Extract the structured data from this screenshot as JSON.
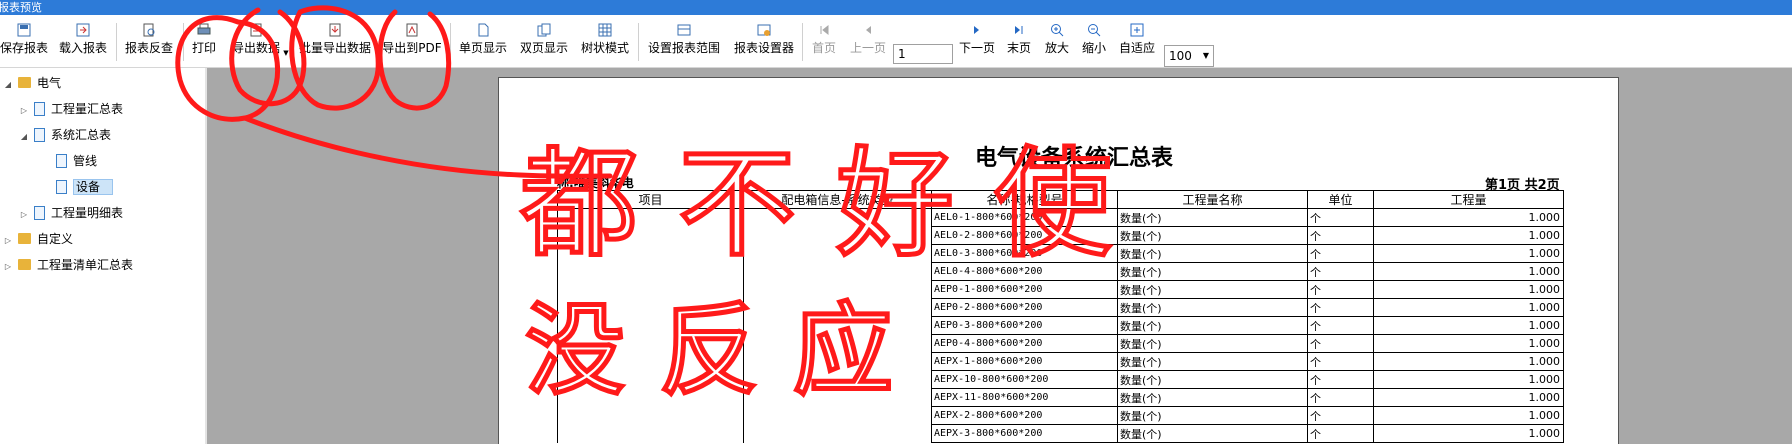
{
  "window": {
    "title": "报表预览"
  },
  "toolbar": {
    "save": "保存报表",
    "load": "载入报表",
    "reverse": "报表反查",
    "print": "打印",
    "export": "导出数据",
    "batch_export": "批量导出数据",
    "export_pdf": "导出到PDF",
    "single_page": "单页显示",
    "double_page": "双页显示",
    "tree_mode": "树状模式",
    "set_range": "设置报表范围",
    "report_settings": "报表设置器",
    "first_page": "首页",
    "prev_page": "上一页",
    "page_value": "1",
    "next_page": "下一页",
    "last_page": "末页",
    "zoom_in": "放大",
    "zoom_out": "缩小",
    "fit": "自适应",
    "zoom_value": "100"
  },
  "tree": [
    {
      "label": "电气",
      "level": 0,
      "type": "folder",
      "expanded": true
    },
    {
      "label": "工程量汇总表",
      "level": 1,
      "type": "doc",
      "expanded": false
    },
    {
      "label": "系统汇总表",
      "level": 1,
      "type": "doc",
      "expanded": true
    },
    {
      "label": "管线",
      "level": 2,
      "type": "doc"
    },
    {
      "label": "设备",
      "level": 2,
      "type": "doc",
      "selected": true
    },
    {
      "label": "工程量明细表",
      "level": 1,
      "type": "doc",
      "expanded": false
    },
    {
      "label": "自定义",
      "level": 0,
      "type": "folder",
      "expanded": false
    },
    {
      "label": "工程量清单汇总表",
      "level": 0,
      "type": "folder",
      "expanded": false
    }
  ],
  "report": {
    "title": "电气设备系统汇总表",
    "unit_label": "称:唯美斜华电",
    "page_info": "第1页  共2页",
    "headers": [
      "项目",
      "配电箱信息-系统类型",
      "名称-规格型号",
      "工程量名称",
      "单位",
      "工程量"
    ],
    "rows": [
      {
        "spec": "AEL0-1-800*600*200",
        "qname": "数量(个)",
        "unit": "个",
        "qty": "1.000"
      },
      {
        "spec": "AEL0-2-800*600*200",
        "qname": "数量(个)",
        "unit": "个",
        "qty": "1.000"
      },
      {
        "spec": "AEL0-3-800*600*200",
        "qname": "数量(个)",
        "unit": "个",
        "qty": "1.000"
      },
      {
        "spec": "AEL0-4-800*600*200",
        "qname": "数量(个)",
        "unit": "个",
        "qty": "1.000"
      },
      {
        "spec": "AEP0-1-800*600*200",
        "qname": "数量(个)",
        "unit": "个",
        "qty": "1.000"
      },
      {
        "spec": "AEP0-2-800*600*200",
        "qname": "数量(个)",
        "unit": "个",
        "qty": "1.000"
      },
      {
        "spec": "AEP0-3-800*600*200",
        "qname": "数量(个)",
        "unit": "个",
        "qty": "1.000"
      },
      {
        "spec": "AEP0-4-800*600*200",
        "qname": "数量(个)",
        "unit": "个",
        "qty": "1.000"
      },
      {
        "spec": "AEPX-1-800*600*200",
        "qname": "数量(个)",
        "unit": "个",
        "qty": "1.000"
      },
      {
        "spec": "AEPX-10-800*600*200",
        "qname": "数量(个)",
        "unit": "个",
        "qty": "1.000"
      },
      {
        "spec": "AEPX-11-800*600*200",
        "qname": "数量(个)",
        "unit": "个",
        "qty": "1.000"
      },
      {
        "spec": "AEPX-2-800*600*200",
        "qname": "数量(个)",
        "unit": "个",
        "qty": "1.000"
      },
      {
        "spec": "AEPX-3-800*600*200",
        "qname": "数量(个)",
        "unit": "个",
        "qty": "1.000"
      }
    ]
  },
  "annotation": {
    "line1": "都不好使",
    "line2": "没反应",
    "color": "#ff1a1a"
  }
}
